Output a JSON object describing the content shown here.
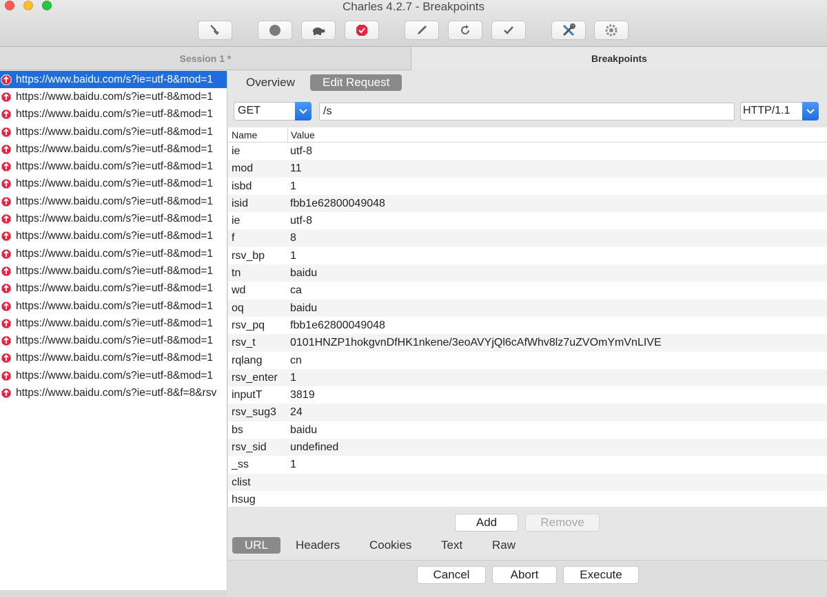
{
  "window": {
    "title": "Charles 4.2.7 - Breakpoints"
  },
  "toolbar": {
    "items": [
      {
        "name": "broom-icon"
      },
      {
        "name": "record-icon"
      },
      {
        "name": "turtle-icon"
      },
      {
        "name": "breakpoint-icon"
      },
      {
        "name": "pen-icon"
      },
      {
        "name": "refresh-icon"
      },
      {
        "name": "check-icon"
      },
      {
        "name": "tools-icon"
      },
      {
        "name": "gear-icon"
      }
    ]
  },
  "tabs": {
    "session": "Session 1 *",
    "breakpoints": "Breakpoints"
  },
  "requests": [
    "https://www.baidu.com/s?ie=utf-8&mod=1",
    "https://www.baidu.com/s?ie=utf-8&mod=1",
    "https://www.baidu.com/s?ie=utf-8&mod=1",
    "https://www.baidu.com/s?ie=utf-8&mod=1",
    "https://www.baidu.com/s?ie=utf-8&mod=1",
    "https://www.baidu.com/s?ie=utf-8&mod=1",
    "https://www.baidu.com/s?ie=utf-8&mod=1",
    "https://www.baidu.com/s?ie=utf-8&mod=1",
    "https://www.baidu.com/s?ie=utf-8&mod=1",
    "https://www.baidu.com/s?ie=utf-8&mod=1",
    "https://www.baidu.com/s?ie=utf-8&mod=1",
    "https://www.baidu.com/s?ie=utf-8&mod=1",
    "https://www.baidu.com/s?ie=utf-8&mod=1",
    "https://www.baidu.com/s?ie=utf-8&mod=1",
    "https://www.baidu.com/s?ie=utf-8&mod=1",
    "https://www.baidu.com/s?ie=utf-8&mod=1",
    "https://www.baidu.com/s?ie=utf-8&mod=1",
    "https://www.baidu.com/s?ie=utf-8&mod=1",
    "https://www.baidu.com/s?ie=utf-8&f=8&rsv"
  ],
  "editor": {
    "overview_label": "Overview",
    "edit_request_label": "Edit Request",
    "method": "GET",
    "path": "/s",
    "protocol": "HTTP/1.1",
    "columns": {
      "name": "Name",
      "value": "Value"
    },
    "params": [
      {
        "name": "ie",
        "value": "utf-8"
      },
      {
        "name": "mod",
        "value": "11"
      },
      {
        "name": "isbd",
        "value": "1"
      },
      {
        "name": "isid",
        "value": "fbb1e62800049048"
      },
      {
        "name": "ie",
        "value": "utf-8"
      },
      {
        "name": "f",
        "value": "8"
      },
      {
        "name": "rsv_bp",
        "value": "1"
      },
      {
        "name": "tn",
        "value": "baidu"
      },
      {
        "name": "wd",
        "value": "ca"
      },
      {
        "name": "oq",
        "value": "baidu"
      },
      {
        "name": "rsv_pq",
        "value": "fbb1e62800049048"
      },
      {
        "name": "rsv_t",
        "value": "0101HNZP1hokgvnDfHK1nkene/3eoAVYjQl6cAfWhv8lz7uZVOmYmVnLIVE"
      },
      {
        "name": "rqlang",
        "value": "cn"
      },
      {
        "name": "rsv_enter",
        "value": "1"
      },
      {
        "name": "inputT",
        "value": "3819"
      },
      {
        "name": "rsv_sug3",
        "value": "24"
      },
      {
        "name": "bs",
        "value": "baidu"
      },
      {
        "name": "rsv_sid",
        "value": "undefined"
      },
      {
        "name": "_ss",
        "value": "1"
      },
      {
        "name": "clist",
        "value": ""
      },
      {
        "name": "hsug",
        "value": ""
      }
    ],
    "add_label": "Add",
    "remove_label": "Remove",
    "subtabs": [
      "URL",
      "Headers",
      "Cookies",
      "Text",
      "Raw"
    ],
    "cancel_label": "Cancel",
    "abort_label": "Abort",
    "execute_label": "Execute"
  }
}
